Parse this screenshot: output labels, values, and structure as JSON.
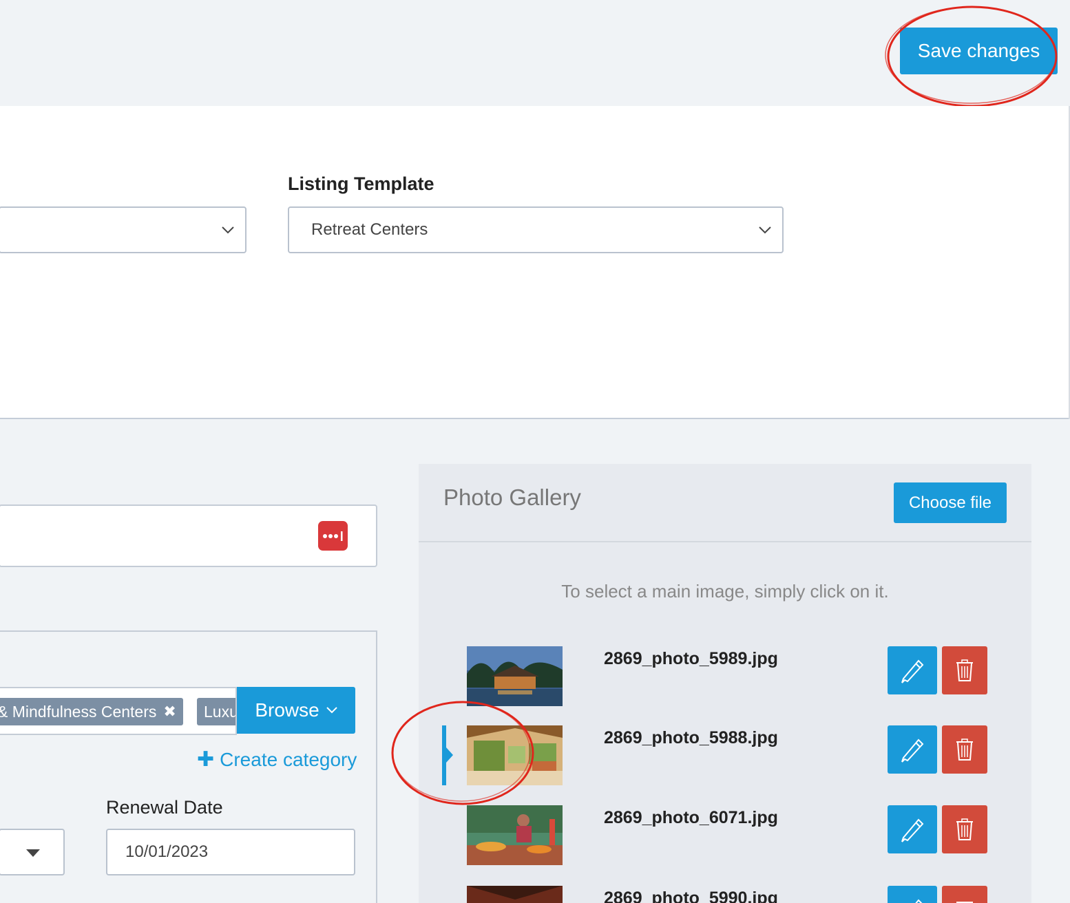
{
  "toolbar": {
    "save_label": "Save changes"
  },
  "form": {
    "left_select_value": "",
    "listing_template": {
      "label": "Listing Template",
      "value": "Retreat Centers"
    }
  },
  "categories": {
    "chips": [
      {
        "label": "& Mindfulness Centers"
      },
      {
        "label": "Luxury Retreats"
      }
    ],
    "browse_label": "Browse",
    "create_label": "Create category"
  },
  "renewal": {
    "label": "Renewal Date",
    "value": "10/01/2023"
  },
  "gallery": {
    "title": "Photo Gallery",
    "choose_label": "Choose file",
    "hint": "To select a main image, simply click on it.",
    "photos": [
      {
        "filename": "2869_photo_5989.jpg",
        "selected": false
      },
      {
        "filename": "2869_photo_5988.jpg",
        "selected": true
      },
      {
        "filename": "2869_photo_6071.jpg",
        "selected": false
      },
      {
        "filename": "2869_photo_5990.jpg",
        "selected": false
      }
    ]
  },
  "colors": {
    "accent": "#1a9ad9",
    "danger": "#d24b3b",
    "annotation": "#e0261c",
    "chip": "#7c8fa4"
  },
  "icons": {
    "dropdown": "chevron-down-icon",
    "password_manager": "password-manager-icon",
    "edit": "pencil-icon",
    "delete": "trash-icon",
    "remove_chip": "close-icon",
    "add": "plus-icon"
  }
}
